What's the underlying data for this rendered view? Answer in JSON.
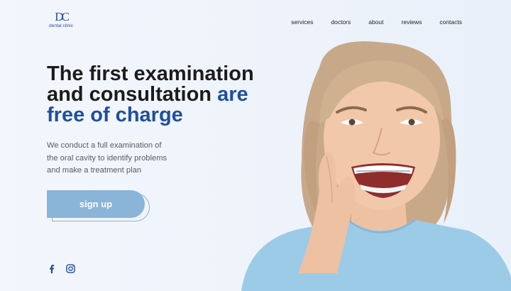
{
  "brand": {
    "mark": "DC",
    "name": "dental clinic"
  },
  "nav": {
    "items": [
      "services",
      "doctors",
      "about",
      "reviews",
      "contacts"
    ]
  },
  "hero": {
    "headline_line1": "The first examination",
    "headline_line2_a": "and consultation",
    "headline_line2_b": "are",
    "headline_line3": "free of charge",
    "description_lines": [
      "We conduct a full examination of",
      "the oral cavity to identify problems",
      "and make a treatment plan"
    ],
    "cta_label": "sign up"
  },
  "social": {
    "icons": [
      "facebook-icon",
      "instagram-icon"
    ]
  },
  "colors": {
    "accent": "#1f4f9e",
    "button": "#8ab4d8",
    "background": "#eef3fb",
    "shirt": "#9ccbe8"
  }
}
